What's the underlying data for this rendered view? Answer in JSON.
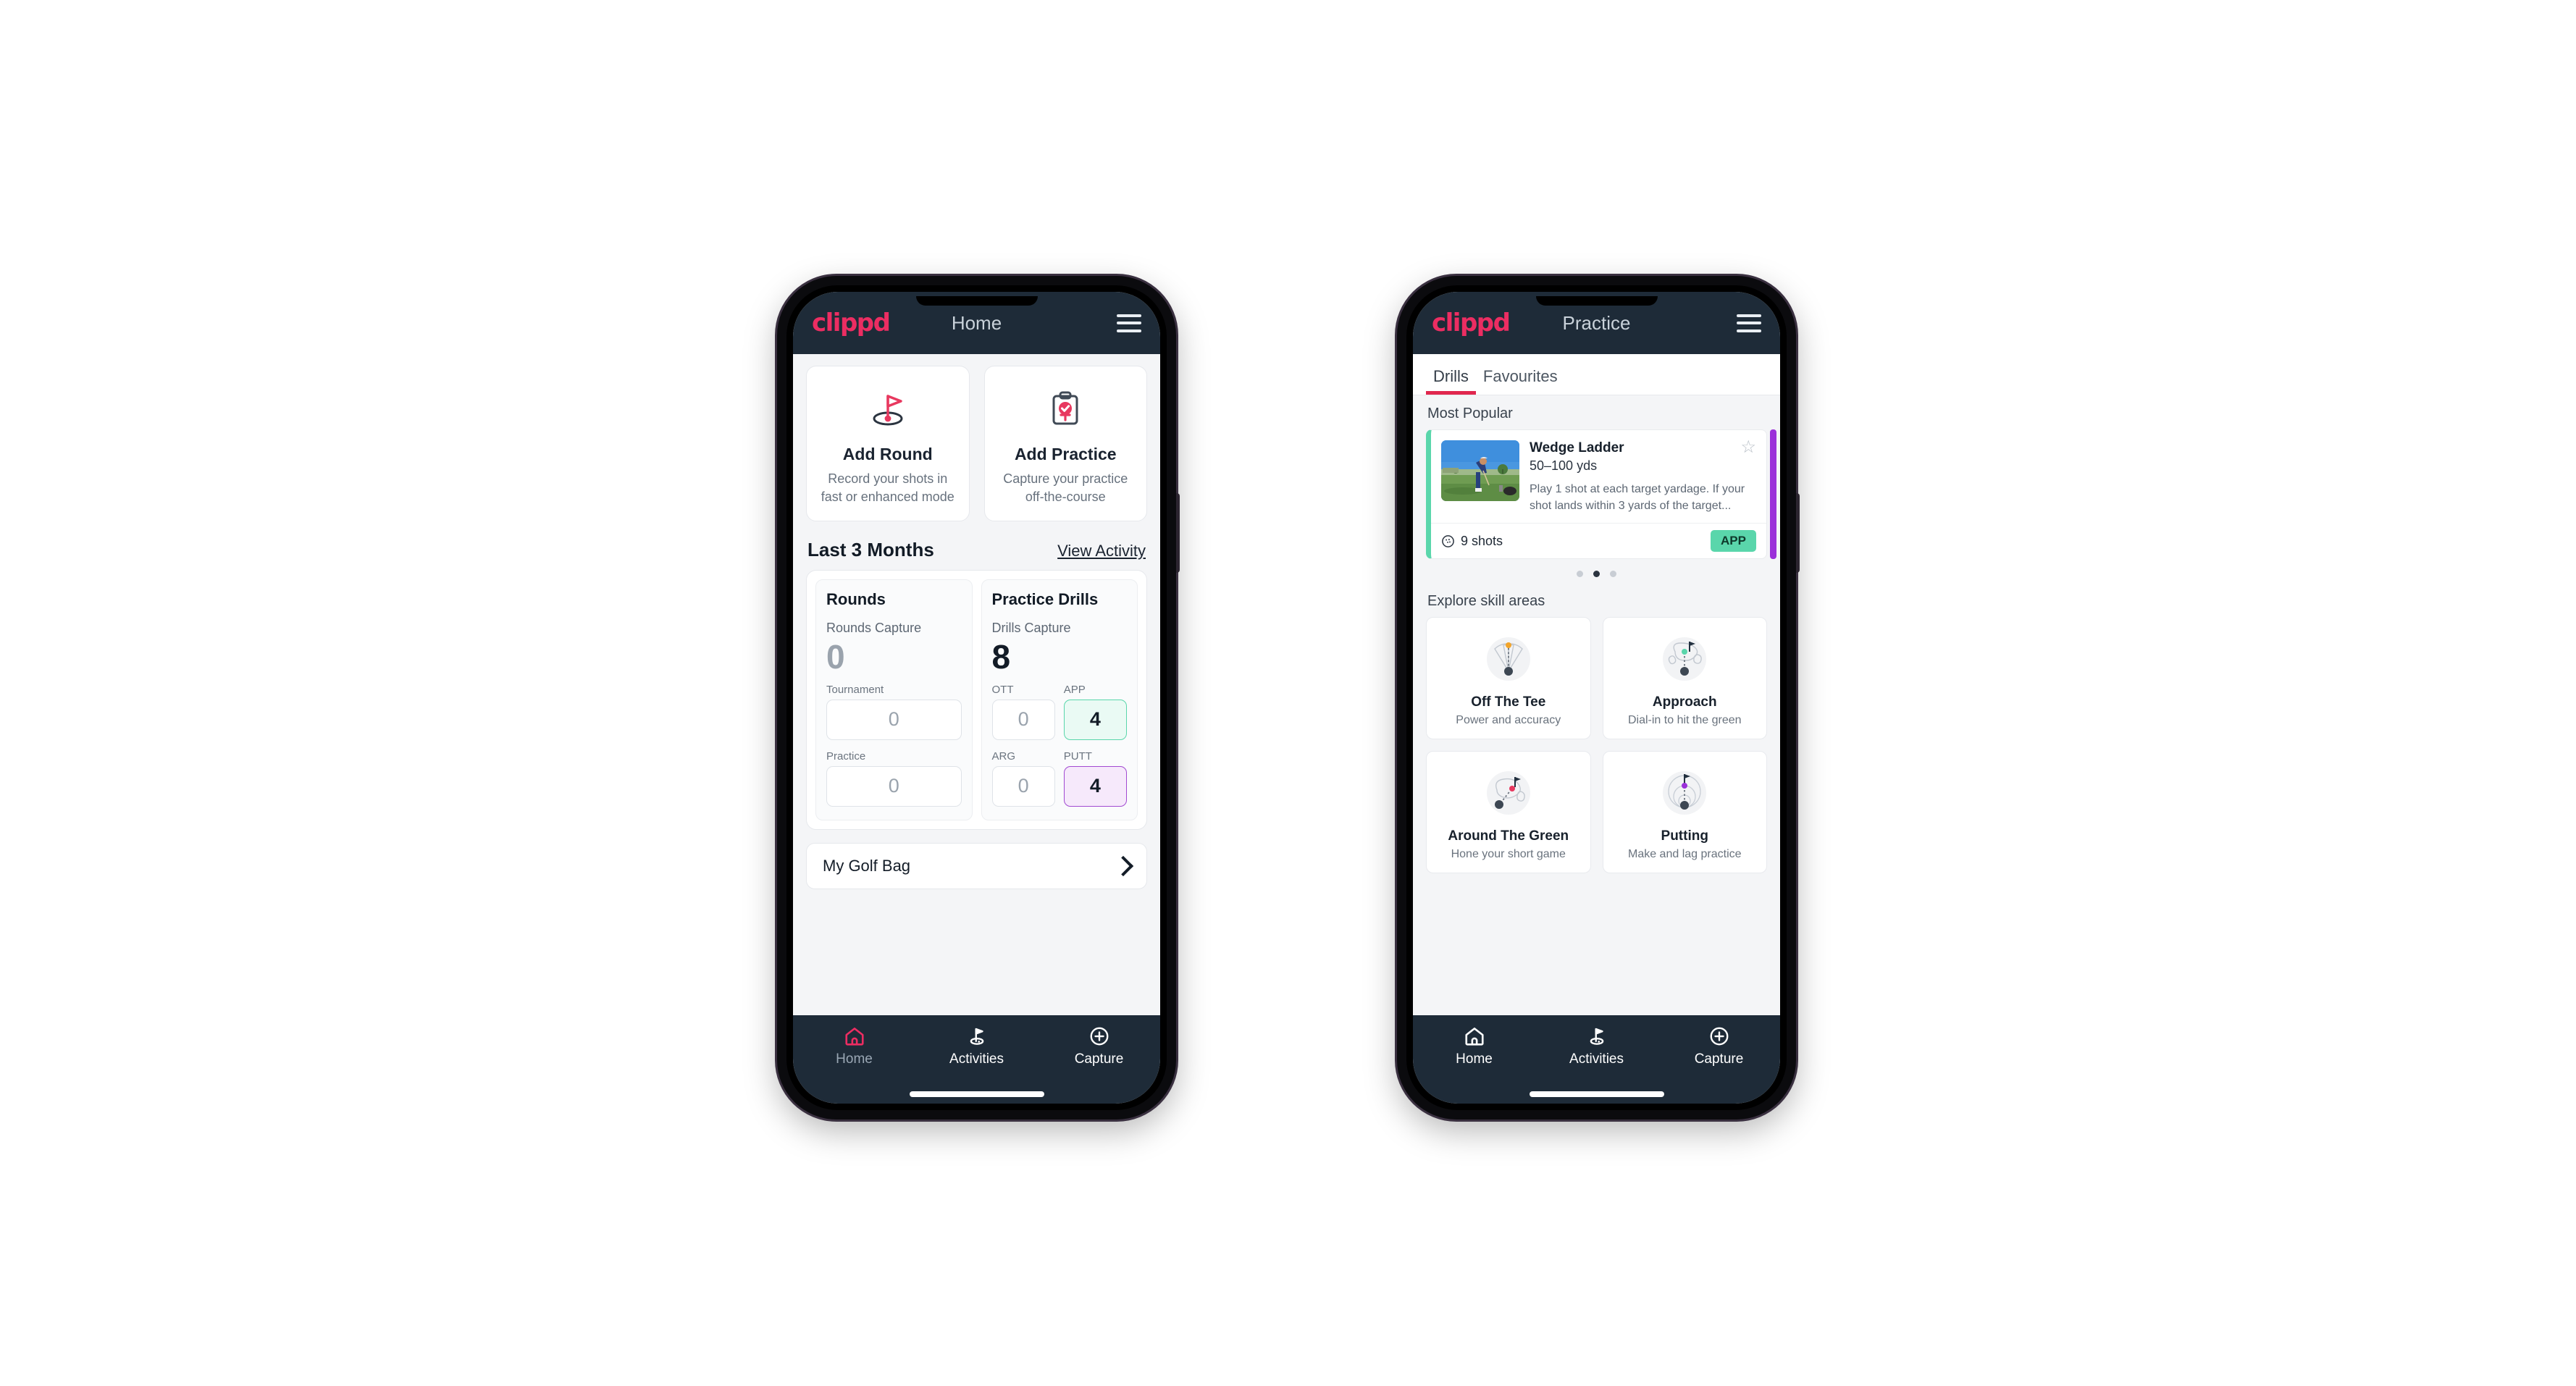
{
  "brand": {
    "name": "clippd",
    "accent": "#ec2d62"
  },
  "phone1": {
    "appbar": {
      "title": "Home",
      "menu": "menu-icon"
    },
    "quick_actions": [
      {
        "icon": "golf-flag-icon",
        "title": "Add Round",
        "subtitle": "Record your shots in fast or enhanced mode"
      },
      {
        "icon": "clipboard-check-icon",
        "title": "Add Practice",
        "subtitle": "Capture your practice off-the-course"
      }
    ],
    "section": {
      "heading": "Last 3 Months",
      "link": "View Activity"
    },
    "stats": {
      "rounds": {
        "heading": "Rounds",
        "capture_label": "Rounds Capture",
        "capture_value": "0",
        "fields": [
          {
            "label": "Tournament",
            "value": "0",
            "state": "empty"
          },
          {
            "label": "Practice",
            "value": "0",
            "state": "empty"
          }
        ]
      },
      "drills": {
        "heading": "Practice Drills",
        "capture_label": "Drills Capture",
        "capture_value": "8",
        "fields": [
          {
            "label": "OTT",
            "value": "0",
            "state": "empty"
          },
          {
            "label": "APP",
            "value": "4",
            "state": "app"
          },
          {
            "label": "ARG",
            "value": "0",
            "state": "empty"
          },
          {
            "label": "PUTT",
            "value": "4",
            "state": "putt"
          }
        ]
      }
    },
    "golf_bag": {
      "label": "My Golf Bag",
      "chevron": "chevron-right-icon"
    },
    "nav": [
      {
        "label": "Home",
        "icon": "home-icon",
        "active": true
      },
      {
        "label": "Activities",
        "icon": "golf-flag-icon",
        "active": false
      },
      {
        "label": "Capture",
        "icon": "plus-circle-icon",
        "active": false
      }
    ]
  },
  "phone2": {
    "appbar": {
      "title": "Practice",
      "menu": "menu-icon"
    },
    "tabs": [
      {
        "label": "Drills",
        "active": true
      },
      {
        "label": "Favourites",
        "active": false
      }
    ],
    "most_popular": {
      "label": "Most Popular",
      "drill": {
        "name": "Wedge Ladder",
        "yardage": "50–100 yds",
        "description": "Play 1 shot at each target yardage. If your shot lands within 3 yards of the target...",
        "shots": "9 shots",
        "shots_icon": "golf-ball-icon",
        "badge": "APP",
        "badge_color": "#5ad6ab",
        "accent_color": "#5ad6ab",
        "next_accent_color": "#9b30d9",
        "favourite_icon": "star-outline-icon",
        "thumbnail": "golfer-driving-range-photo"
      },
      "dots": [
        false,
        true,
        false
      ]
    },
    "explore": {
      "label": "Explore skill areas",
      "skills": [
        {
          "name": "Off The Tee",
          "desc": "Power and accuracy",
          "icon": "tee-fan-icon",
          "dot_color": "#f2a42a"
        },
        {
          "name": "Approach",
          "desc": "Dial-in to hit the green",
          "icon": "green-approach-icon",
          "dot_color": "#5ad6ab"
        },
        {
          "name": "Around The Green",
          "desc": "Hone your short game",
          "icon": "chip-green-icon",
          "dot_color": "#e8385f"
        },
        {
          "name": "Putting",
          "desc": "Make and lag practice",
          "icon": "putting-rings-icon",
          "dot_color": "#9b30d9"
        }
      ]
    },
    "nav": [
      {
        "label": "Home",
        "icon": "home-icon",
        "active": false
      },
      {
        "label": "Activities",
        "icon": "golf-flag-icon",
        "active": true
      },
      {
        "label": "Capture",
        "icon": "plus-circle-icon",
        "active": false
      }
    ]
  }
}
